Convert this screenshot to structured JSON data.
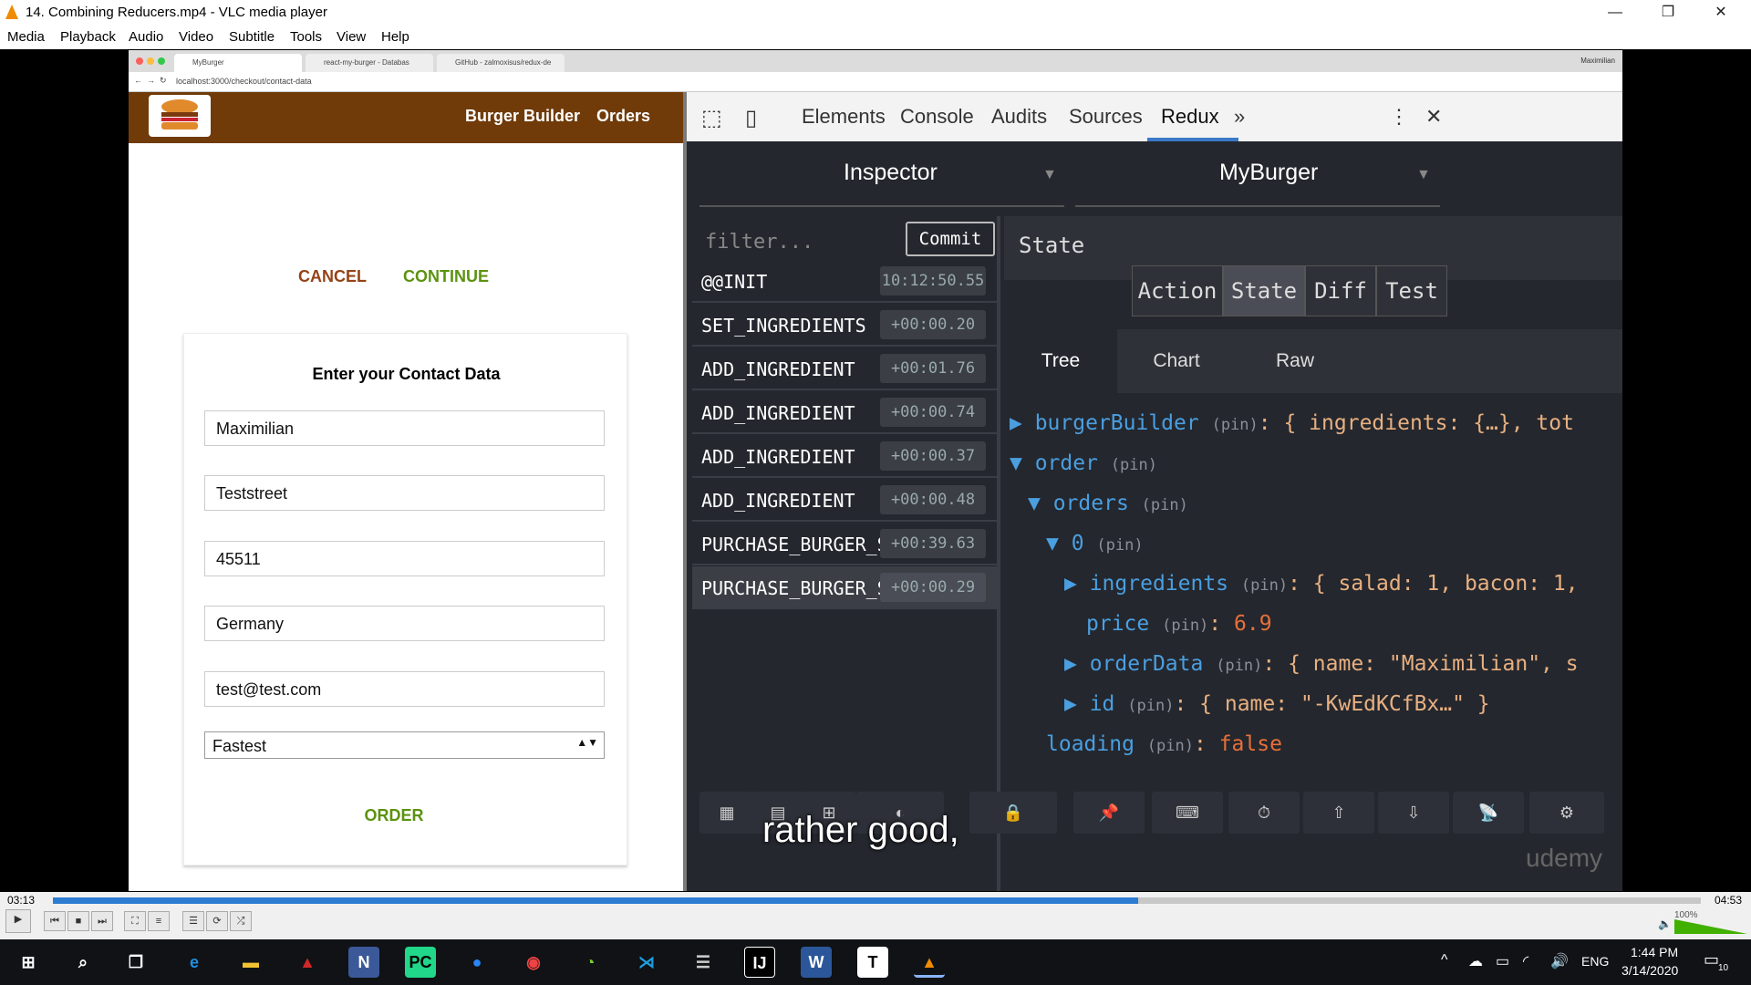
{
  "window": {
    "title": "14. Combining Reducers.mp4 - VLC media player"
  },
  "menu": [
    "Media",
    "Playback",
    "Audio",
    "Video",
    "Subtitle",
    "Tools",
    "View",
    "Help"
  ],
  "browser": {
    "tabs": [
      "MyBurger",
      "react-my-burger - Databas",
      "GitHub - zalmoxisus/redux-de"
    ],
    "url": "localhost:3000/checkout/contact-data",
    "profile": "Maximilian"
  },
  "app": {
    "nav": [
      "Burger Builder",
      "Orders"
    ],
    "cancel": "CANCEL",
    "continue": "CONTINUE",
    "form_title": "Enter your Contact Data",
    "fields": [
      "Maximilian",
      "Teststreet",
      "45511",
      "Germany",
      "test@test.com"
    ],
    "delivery": "Fastest",
    "order_button": "ORDER"
  },
  "devtools": {
    "tabs": [
      "Elements",
      "Console",
      "Audits",
      "Sources",
      "Redux"
    ],
    "active_tab": "Redux",
    "inspector": "Inspector",
    "instance": "MyBurger",
    "filter_placeholder": "filter...",
    "commit": "Commit",
    "actions": [
      {
        "name": "@@INIT",
        "time": "10:12:50.55"
      },
      {
        "name": "SET_INGREDIENTS",
        "time": "+00:00.20"
      },
      {
        "name": "ADD_INGREDIENT",
        "time": "+00:01.76"
      },
      {
        "name": "ADD_INGREDIENT",
        "time": "+00:00.74"
      },
      {
        "name": "ADD_INGREDIENT",
        "time": "+00:00.37"
      },
      {
        "name": "ADD_INGREDIENT",
        "time": "+00:00.48"
      },
      {
        "name": "PURCHASE_BURGER_S...",
        "time": "+00:39.63"
      },
      {
        "name": "PURCHASE_BURGER_S...",
        "time": "+00:00.29"
      }
    ],
    "header_label": "State",
    "modes": [
      "Action",
      "State",
      "Diff",
      "Test"
    ],
    "subtabs": [
      "Tree",
      "Chart",
      "Raw"
    ],
    "tree": {
      "l1_key": "burgerBuilder",
      "l1_val": "{ ingredients: {…}, tot",
      "l2_key": "order",
      "l3_key": "orders",
      "l4_key": "0",
      "l5a_key": "ingredients",
      "l5a_val": "{ salad: 1, bacon: 1,",
      "l5b_key": "price",
      "l5b_val": "6.9",
      "l5c_key": "orderData",
      "l5c_val": "{ name: \"Maximilian\", s",
      "l5d_key": "id",
      "l5d_val": "{ name: \"-KwEdKCfBx…\" }",
      "l6_key": "loading",
      "l6_val": "false",
      "pin": "(pin)",
      "sep": ":"
    },
    "watermark": "udemy"
  },
  "subtitle": "rather good,",
  "player": {
    "elapsed": "03:13",
    "total": "04:53",
    "volume": "100%",
    "progress": 0.659
  },
  "taskbar": {
    "time": "1:44 PM",
    "date": "3/14/2020",
    "lang": "ENG",
    "notifications": "10"
  }
}
